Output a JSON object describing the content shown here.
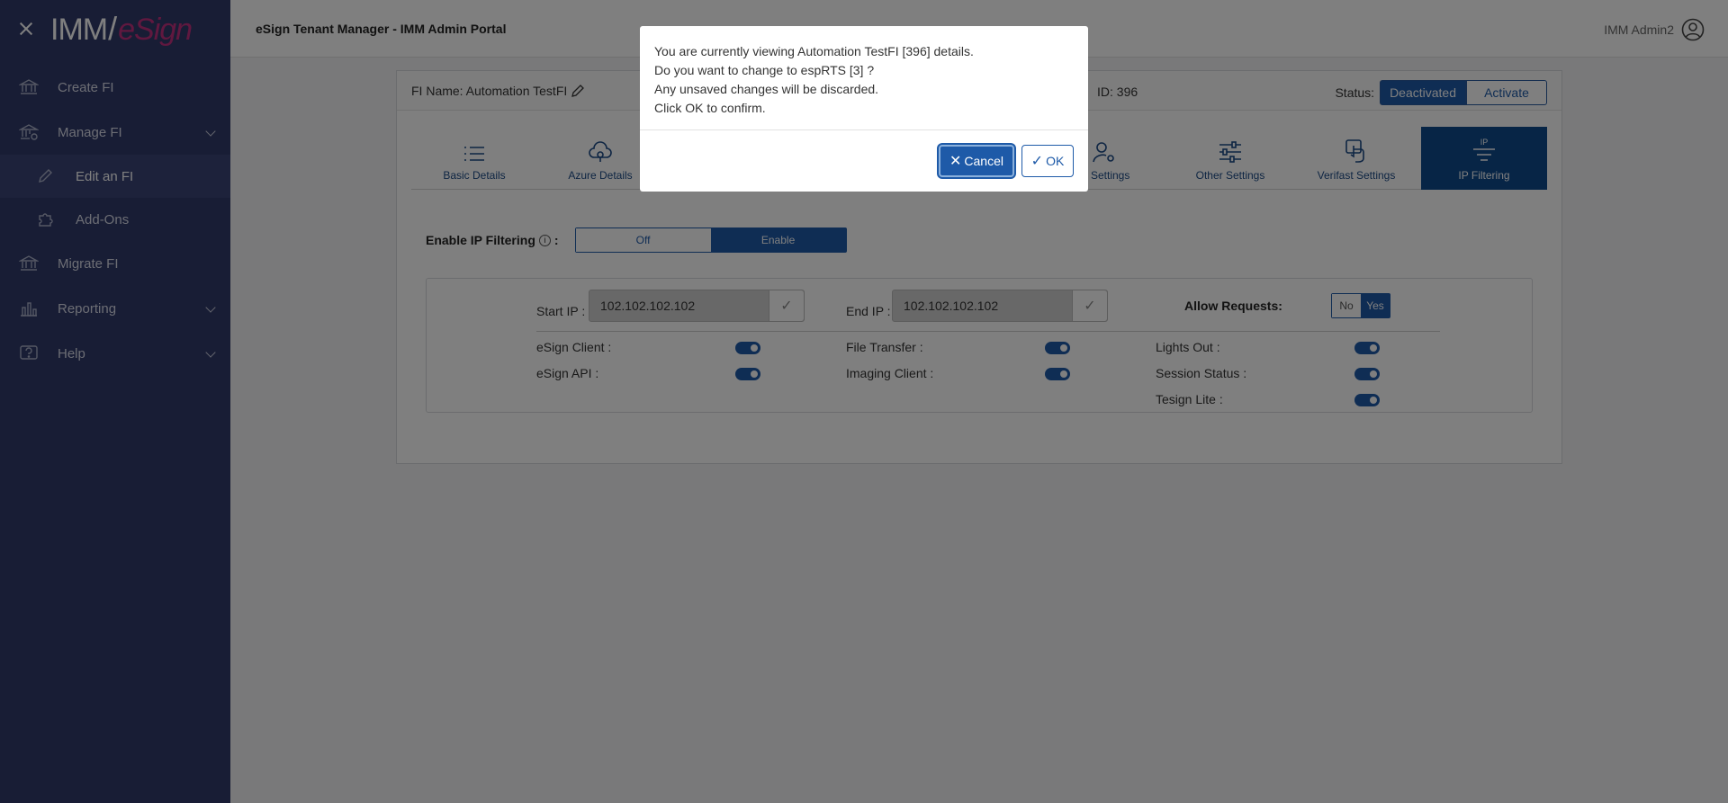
{
  "sidebar": {
    "logo_left": "IMM",
    "logo_right": "eSign",
    "items": [
      {
        "label": "Create FI"
      },
      {
        "label": "Manage FI"
      },
      {
        "label": "Edit an FI"
      },
      {
        "label": "Add-Ons"
      },
      {
        "label": "Migrate FI"
      },
      {
        "label": "Reporting"
      },
      {
        "label": "Help"
      }
    ]
  },
  "header": {
    "title": "eSign Tenant Manager - IMM Admin Portal",
    "user": "IMM Admin2"
  },
  "card": {
    "fi_name": "FI Name: Automation TestFI",
    "fi_id": "ID: 396",
    "status_label": "Status:",
    "status_active": "Deactivated",
    "status_other": "Activate",
    "tabs": [
      {
        "label": "Basic Details"
      },
      {
        "label": "Azure Details"
      },
      {
        "label": "nt Settings"
      },
      {
        "label": "Other Settings"
      },
      {
        "label": "Verifast Settings"
      },
      {
        "label": "IP Filtering",
        "icon_caption": "IP"
      }
    ]
  },
  "ip_filtering": {
    "label": "Enable IP Filtering",
    "info": "i",
    "colon": ":",
    "off_label": "Off",
    "on_label": "Enable",
    "start_label": "Start IP :",
    "start_value": "102.102.102.102",
    "end_label": "End IP :",
    "end_value": "102.102.102.102",
    "check_glyph": "✓",
    "allow_label": "Allow Requests:",
    "no_label": "No",
    "yes_label": "Yes",
    "switches": [
      {
        "label": "eSign Client :",
        "on": true
      },
      {
        "label": "eSign API :",
        "on": true
      },
      {
        "label": "File Transfer :",
        "on": true
      },
      {
        "label": "Imaging Client :",
        "on": true
      },
      {
        "label": "Lights Out :",
        "on": true
      },
      {
        "label": "Session Status :",
        "on": true
      },
      {
        "label": "Tesign Lite :",
        "on": true
      }
    ]
  },
  "modal": {
    "lines": [
      "You are currently viewing Automation TestFI [396] details.",
      "Do you want to change to espRTS [3] ?",
      "Any unsaved changes will be discarded.",
      "Click OK to confirm."
    ],
    "cancel_label": "Cancel",
    "ok_label": "OK",
    "cancel_glyph": "✕",
    "ok_glyph": "✓"
  },
  "colors": {
    "sidebar_bg": "#303a6b",
    "accent": "#1e5aa8",
    "active_tab": "#0e4a8c",
    "logo_accent": "#c0307e"
  }
}
